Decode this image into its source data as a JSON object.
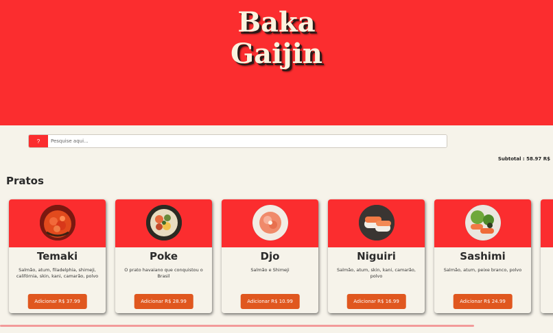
{
  "brand": {
    "line1": "Baka",
    "line2": "Gaijin"
  },
  "search": {
    "button_label": "?",
    "placeholder": "Pesquise aqui..."
  },
  "cart": {
    "subtotal_label": "Subtotal : 58.97 R$"
  },
  "section": {
    "title": "Pratos"
  },
  "items": [
    {
      "name": "Temaki",
      "description": "Salmão, atum, filadelphia, shimeji, califórnia, skin, kani, camarão, polvo",
      "button": "Adicionar R$ 37.99"
    },
    {
      "name": "Poke",
      "description": "O prato havaiano que conquistou o Brasil",
      "button": "Adicionar R$ 28.99"
    },
    {
      "name": "Djo",
      "description": "Salmão e Shimeji",
      "button": "Adicionar R$ 10.99"
    },
    {
      "name": "Niguiri",
      "description": "Salmão, atum, skin, kani, camarão, polvo",
      "button": "Adicionar R$ 16.99"
    },
    {
      "name": "Sashimi",
      "description": "Salmão, atum, peixe branco, polvo",
      "button": "Adicionar R$ 24.99"
    }
  ],
  "colors": {
    "brand_red": "#fb2d2f",
    "button_orange": "#e0571f",
    "background": "#f6f3ea"
  }
}
